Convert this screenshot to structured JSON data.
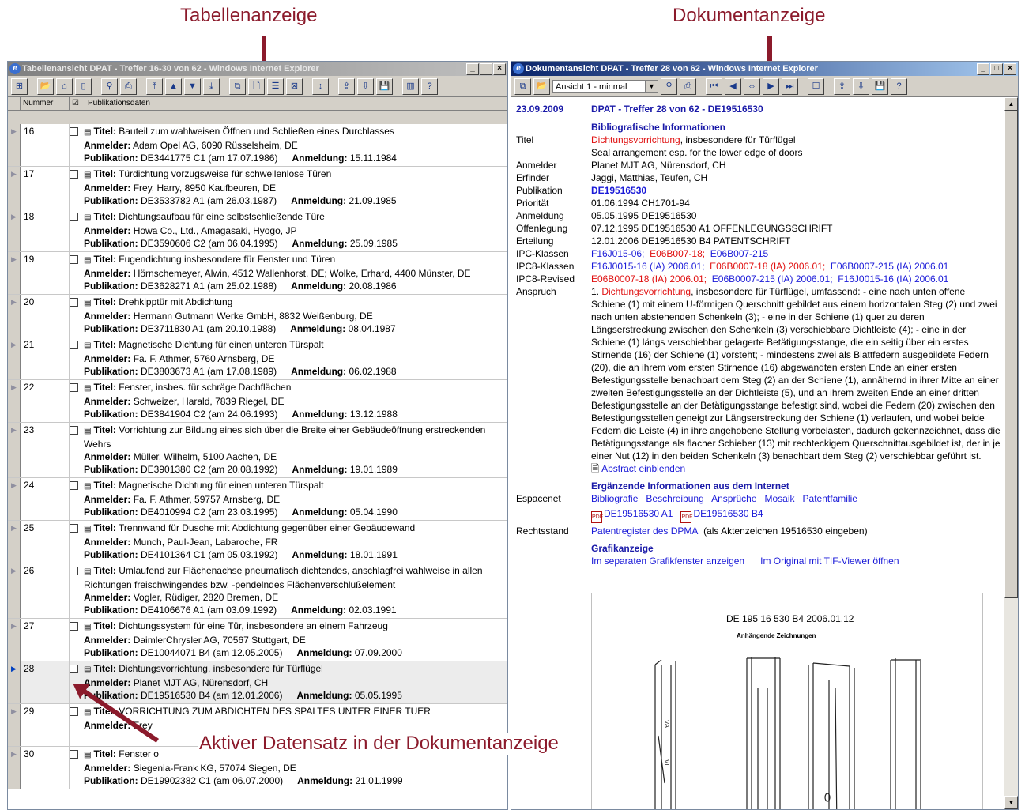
{
  "annotations": {
    "table_label": "Tabellenanzeige",
    "document_label": "Dokumentanzeige",
    "active_label": "Aktiver Datensatz in der Dokumentanzeige",
    "color": "#8b1a2b"
  },
  "left_window": {
    "title": "Tabellenansicht DPAT - Treffer 16-30 von 62 - Windows Internet Explorer",
    "columns": [
      "Nummer",
      "☑",
      "Publikationsdaten"
    ],
    "rows": [
      {
        "num": "16",
        "titel": "Bauteil zum wahlweisen Öffnen und Schließen eines Durchlasses",
        "anmelder": "Adam Opel AG, 6090 Rüsselsheim, DE",
        "publikation": "DE3441775 C1  (am 17.07.1986)",
        "anmeldung": "15.11.1984"
      },
      {
        "num": "17",
        "titel": "Türdichtung vorzugsweise für schwellenlose Türen",
        "anmelder": "Frey, Harry, 8950 Kaufbeuren, DE",
        "publikation": "DE3533782 A1  (am 26.03.1987)",
        "anmeldung": "21.09.1985"
      },
      {
        "num": "18",
        "titel": "Dichtungsaufbau für eine selbstschließende Türe",
        "anmelder": "Howa Co., Ltd., Amagasaki, Hyogo, JP",
        "publikation": "DE3590606 C2  (am 06.04.1995)",
        "anmeldung": "25.09.1985"
      },
      {
        "num": "19",
        "titel": "Fugendichtung insbesondere für Fenster und Türen",
        "anmelder": "Hörnschemeyer, Alwin, 4512 Wallenhorst, DE; Wolke, Erhard, 4400 Münster, DE",
        "publikation": "DE3628271 A1  (am 25.02.1988)",
        "anmeldung": "20.08.1986"
      },
      {
        "num": "20",
        "titel": "Drehkipptür mit Abdichtung",
        "anmelder": "Hermann Gutmann Werke GmbH, 8832 Weißenburg, DE",
        "publikation": "DE3711830 A1  (am 20.10.1988)",
        "anmeldung": "08.04.1987"
      },
      {
        "num": "21",
        "titel": "Magnetische Dichtung für einen unteren Türspalt",
        "anmelder": "Fa. F. Athmer, 5760 Arnsberg, DE",
        "publikation": "DE3803673 A1  (am 17.08.1989)",
        "anmeldung": "06.02.1988"
      },
      {
        "num": "22",
        "titel": "Fenster, insbes. für schräge Dachflächen",
        "anmelder": "Schweizer, Harald, 7839 Riegel, DE",
        "publikation": "DE3841904 C2  (am 24.06.1993)",
        "anmeldung": "13.12.1988"
      },
      {
        "num": "23",
        "titel": "Vorrichtung zur Bildung eines sich über die Breite einer Gebäudeöffnung erstreckenden Wehrs",
        "anmelder": "Müller, Wilhelm, 5100 Aachen, DE",
        "publikation": "DE3901380 C2  (am 20.08.1992)",
        "anmeldung": "19.01.1989"
      },
      {
        "num": "24",
        "titel": "Magnetische Dichtung für einen unteren Türspalt",
        "anmelder": "Fa. F. Athmer, 59757 Arnsberg, DE",
        "publikation": "DE4010994 C2  (am 23.03.1995)",
        "anmeldung": "05.04.1990"
      },
      {
        "num": "25",
        "titel": "Trennwand für Dusche mit Abdichtung gegenüber einer Gebäudewand",
        "anmelder": "Munch, Paul-Jean, Labaroche, FR",
        "publikation": "DE4101364 C1  (am 05.03.1992)",
        "anmeldung": "18.01.1991"
      },
      {
        "num": "26",
        "titel": "Umlaufend zur Flächenachse pneumatisch dichtendes, anschlagfrei wahlweise in allen Richtungen freischwingendes bzw. -pendelndes Flächenverschlußelement",
        "anmelder": "Vogler, Rüdiger, 2820 Bremen, DE",
        "publikation": "DE4106676 A1  (am 03.09.1992)",
        "anmeldung": "02.03.1991"
      },
      {
        "num": "27",
        "titel": "Dichtungssystem für eine Tür, insbesondere an einem Fahrzeug",
        "anmelder": "DaimlerChrysler AG, 70567 Stuttgart, DE",
        "publikation": "DE10044071 B4  (am 12.05.2005)",
        "anmeldung": "07.09.2000"
      },
      {
        "num": "28",
        "titel": "Dichtungsvorrichtung, insbesondere für Türflügel",
        "anmelder": "Planet MJT AG, Nürensdorf, CH",
        "publikation": "DE19516530 B4  (am 12.01.2006)",
        "anmeldung": "05.05.1995",
        "active": true
      },
      {
        "num": "29",
        "titel": "VORRICHTUNG ZUM ABDICHTEN DES SPALTES UNTER EINER TUER",
        "anmelder": "Frey",
        "publikation": "",
        "anmeldung": "",
        "partial": true
      },
      {
        "num": "30",
        "titel": "Fenster o",
        "anmelder": "Siegenia-Frank KG, 57074 Siegen, DE",
        "publikation": "DE19902382 C1  (am 06.07.2000)",
        "anmeldung": "21.01.1999",
        "partial": true
      }
    ],
    "labels": {
      "titel": "Titel:",
      "anmelder": "Anmelder:",
      "publikation": "Publikation:",
      "anmeldung": "Anmeldung:"
    }
  },
  "right_window": {
    "title": "Dokumentansicht DPAT - Treffer 28 von 62 - Windows Internet Explorer",
    "view_select": "Ansicht 1 - minmal",
    "date": "23.09.2009",
    "heading": "DPAT - Treffer 28 von 62 - DE19516530",
    "bib_heading": "Bibliografische Informationen",
    "fields": {
      "titel_label": "Titel",
      "titel_red": "Dichtungsvorrichtung",
      "titel_rest": ", insbesondere für Türflügel",
      "titel_en": "Seal arrangement esp. for the lower edge of doors",
      "anmelder_label": "Anmelder",
      "anmelder": "Planet MJT AG, Nürensdorf, CH",
      "erfinder_label": "Erfinder",
      "erfinder": "Jaggi, Matthias, Teufen, CH",
      "publikation_label": "Publikation",
      "publikation": "DE19516530",
      "prioritaet_label": "Priorität",
      "prioritaet": "01.06.1994  CH1701-94",
      "anmeldung_label": "Anmeldung",
      "anmeldung": "05.05.1995  DE19516530",
      "offenlegung_label": "Offenlegung",
      "offenlegung": "07.12.1995  DE19516530 A1 OFFENLEGUNGSSCHRIFT",
      "erteilung_label": "Erteilung",
      "erteilung": "12.01.2006  DE19516530 B4 PATENTSCHRIFT",
      "ipc_label": "IPC-Klassen",
      "ipc_1": "F16J015-06;",
      "ipc_2": "E06B007-18;",
      "ipc_3": "E06B007-215",
      "ipc8_label": "IPC8-Klassen",
      "ipc8_1": "F16J0015-16 (IA) 2006.01;",
      "ipc8_2": "E06B0007-18 (IA) 2006.01;",
      "ipc8_3": "E06B0007-215 (IA) 2006.01",
      "ipc8r_label": "IPC8-Revised",
      "ipc8r_1": "E06B0007-18 (IA) 2006.01;",
      "ipc8r_2": "E06B0007-215 (IA) 2006.01;",
      "ipc8r_3": "F16J0015-16 (IA) 2006.01",
      "anspruch_label": "Anspruch",
      "anspruch_prefix": "1. ",
      "anspruch_red": "Dichtungsvorrichtung",
      "anspruch_text": ", insbesondere für Türflügel, umfassend: - eine nach unten offene Schiene (1) mit einem U-förmigen Querschnitt gebildet aus einem horizontalen Steg (2) und zwei nach unten abstehenden Schenkeln (3); - eine in der Schiene (1) quer zu deren Längserstreckung zwischen den Schenkeln (3) verschiebbare Dichtleiste (4); - eine in der Schiene (1) längs verschiebbar gelagerte Betätigungsstange, die ein seitig über ein erstes Stirnende (16) der Schiene (1) vorsteht; - mindestens zwei als Blattfedern ausgebildete Federn (20), die an ihrem vom ersten Stirnende (16) abgewandten ersten Ende an einer ersten Befestigungsstelle benachbart dem Steg (2) an der Schiene (1), annähernd in ihrer Mitte an einer zweiten Befestigungsstelle an der Dichtleiste (5), und an ihrem zweiten Ende an einer dritten Befestigungsstelle an der Betätigungsstange befestigt sind, wobei die Federn (20) zwischen den Befestigungsstellen geneigt zur Längserstreckung der Schiene (1) verlaufen, und wobei beide Federn die Leiste (4) in ihre angehobene Stellung vorbelasten, dadurch gekennzeichnet, dass die Betätigungsstange als flacher Schieber (13) mit rechteckigem Querschnittausgebildet ist, der in je einer Nut (12) in den beiden Schenkeln (3) benachbart dem Steg (2) verschiebbar geführt ist.",
      "abstract_link": "Abstract einblenden"
    },
    "internet_heading": "Ergänzende Informationen aus dem Internet",
    "espacenet_label": "Espacenet",
    "espacenet_links": [
      "Bibliografie",
      "Beschreibung",
      "Ansprüche",
      "Mosaik",
      "Patentfamilie"
    ],
    "pdf_links": [
      "DE19516530 A1",
      "DE19516530 B4"
    ],
    "rechtsstand_label": "Rechtsstand",
    "rechtsstand_link": "Patentregister des DPMA",
    "rechtsstand_note": "(als Aktenzeichen 19516530 eingeben)",
    "grafik_heading": "Grafikanzeige",
    "grafik_link1": "Im separaten Grafikfenster anzeigen",
    "grafik_link2": "Im Original mit TIF-Viewer öffnen",
    "drawing_title": "DE 195 16 530 B4    2006.01.12",
    "drawing_subtitle": "Anhängende Zeichnungen"
  }
}
